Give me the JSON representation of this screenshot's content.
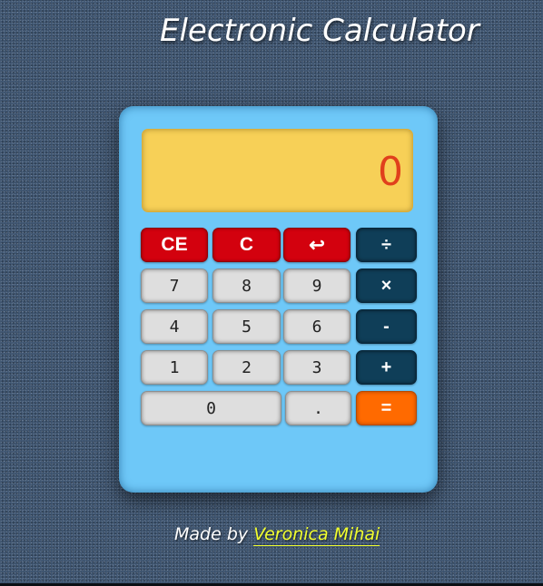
{
  "page_title": "Electronic Calculator",
  "display": {
    "value": "0"
  },
  "keys": {
    "ce": "CE",
    "c": "C",
    "backspace": "↩",
    "divide": "÷",
    "multiply": "×",
    "minus": "-",
    "plus": "+",
    "equals": "=",
    "decimal": ".",
    "d0": "0",
    "d1": "1",
    "d2": "2",
    "d3": "3",
    "d4": "4",
    "d5": "5",
    "d6": "6",
    "d7": "7",
    "d8": "8",
    "d9": "9"
  },
  "footer": {
    "prefix": "Made by",
    "author": "Veronica Mihai"
  },
  "colors": {
    "body_bg": "#3d5470",
    "calculator_body": "#6ec8f8",
    "display_bg": "#f7d057",
    "display_text": "#e0401c",
    "clear_keys": "#d3010e",
    "operator_keys": "#0f3e58",
    "equals_key": "#ff6a00",
    "digit_keys": "#dedede",
    "author_link": "#f2ff2e"
  }
}
